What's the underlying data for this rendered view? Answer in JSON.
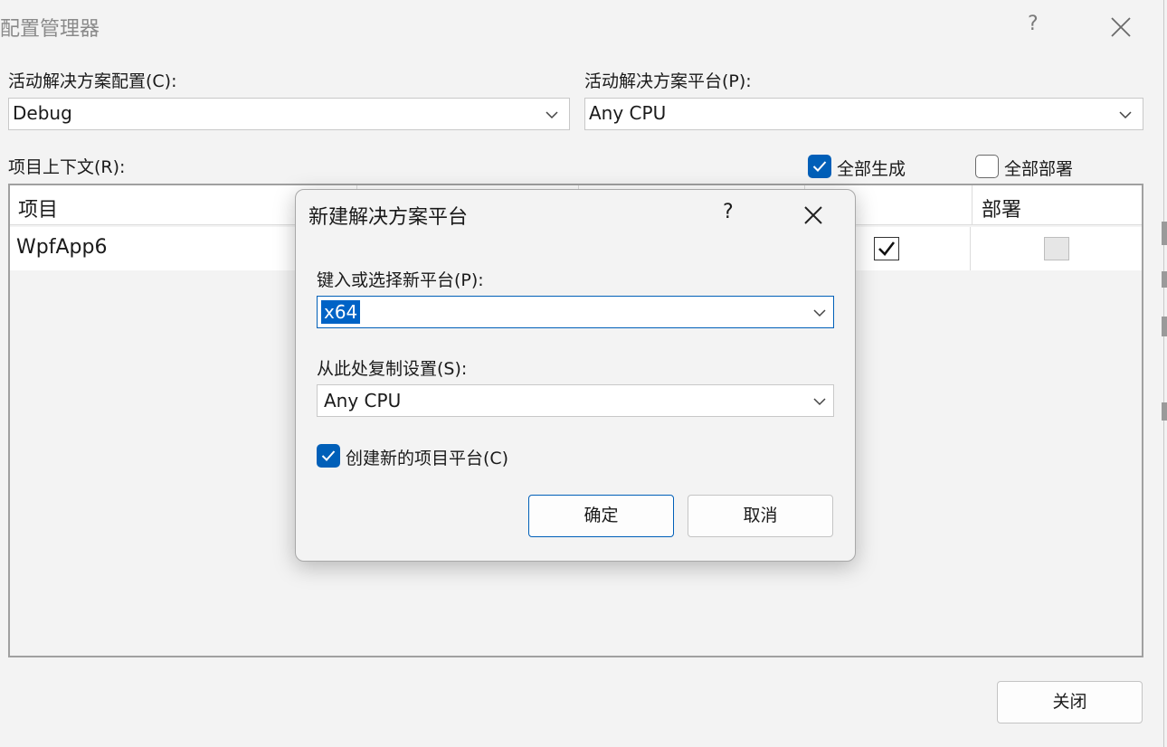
{
  "window": {
    "title": "配置管理器",
    "help": "?",
    "config_label": "活动解决方案配置(C):",
    "config_value": "Debug",
    "platform_label": "活动解决方案平台(P):",
    "platform_value": "Any CPU",
    "context_label": "项目上下文(R):",
    "build_all_label": "全部生成",
    "build_all_checked": true,
    "deploy_all_label": "全部部署",
    "deploy_all_checked": false,
    "close_button": "关闭"
  },
  "grid": {
    "headers": [
      "项目",
      "",
      "",
      "",
      "部署"
    ],
    "rows": [
      {
        "project": "WpfApp6",
        "build": true,
        "deploy": false
      }
    ]
  },
  "dialog": {
    "title": "新建解决方案平台",
    "help": "?",
    "new_platform_label": "键入或选择新平台(P):",
    "new_platform_value": "x64",
    "copy_from_label": "从此处复制设置(S):",
    "copy_from_value": "Any CPU",
    "create_project_platforms_label": "创建新的项目平台(C)",
    "create_project_platforms_checked": true,
    "ok_button": "确定",
    "cancel_button": "取消"
  },
  "colors": {
    "accent": "#005fb8",
    "selection": "#0063c6",
    "background": "#f3f3f3"
  }
}
